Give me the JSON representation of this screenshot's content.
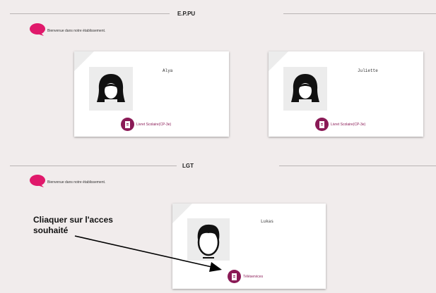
{
  "sections": [
    {
      "title": "E.P.PU",
      "welcome": "Bienvenue dans notre établissement.",
      "cards": [
        {
          "name": "Alya",
          "avatar_icon": "female-avatar-icon",
          "service_label": "Livret Scolaire(CP-3e)"
        },
        {
          "name": "Juliette",
          "avatar_icon": "female-avatar-icon",
          "service_label": "Livret Scolaire(CP-3e)"
        }
      ]
    },
    {
      "title": "LGT",
      "welcome": "Bienvenue dans notre établissement.",
      "cards": [
        {
          "name": "Lukas",
          "avatar_icon": "male-avatar-icon",
          "service_label": "Téléservices"
        }
      ]
    }
  ],
  "annotation": {
    "line1": "Cliaquer sur l'acces",
    "line2": "souhaité"
  },
  "colors": {
    "background": "#f1ecec",
    "accent": "#8a1a56",
    "bubble": "#e0196b"
  }
}
